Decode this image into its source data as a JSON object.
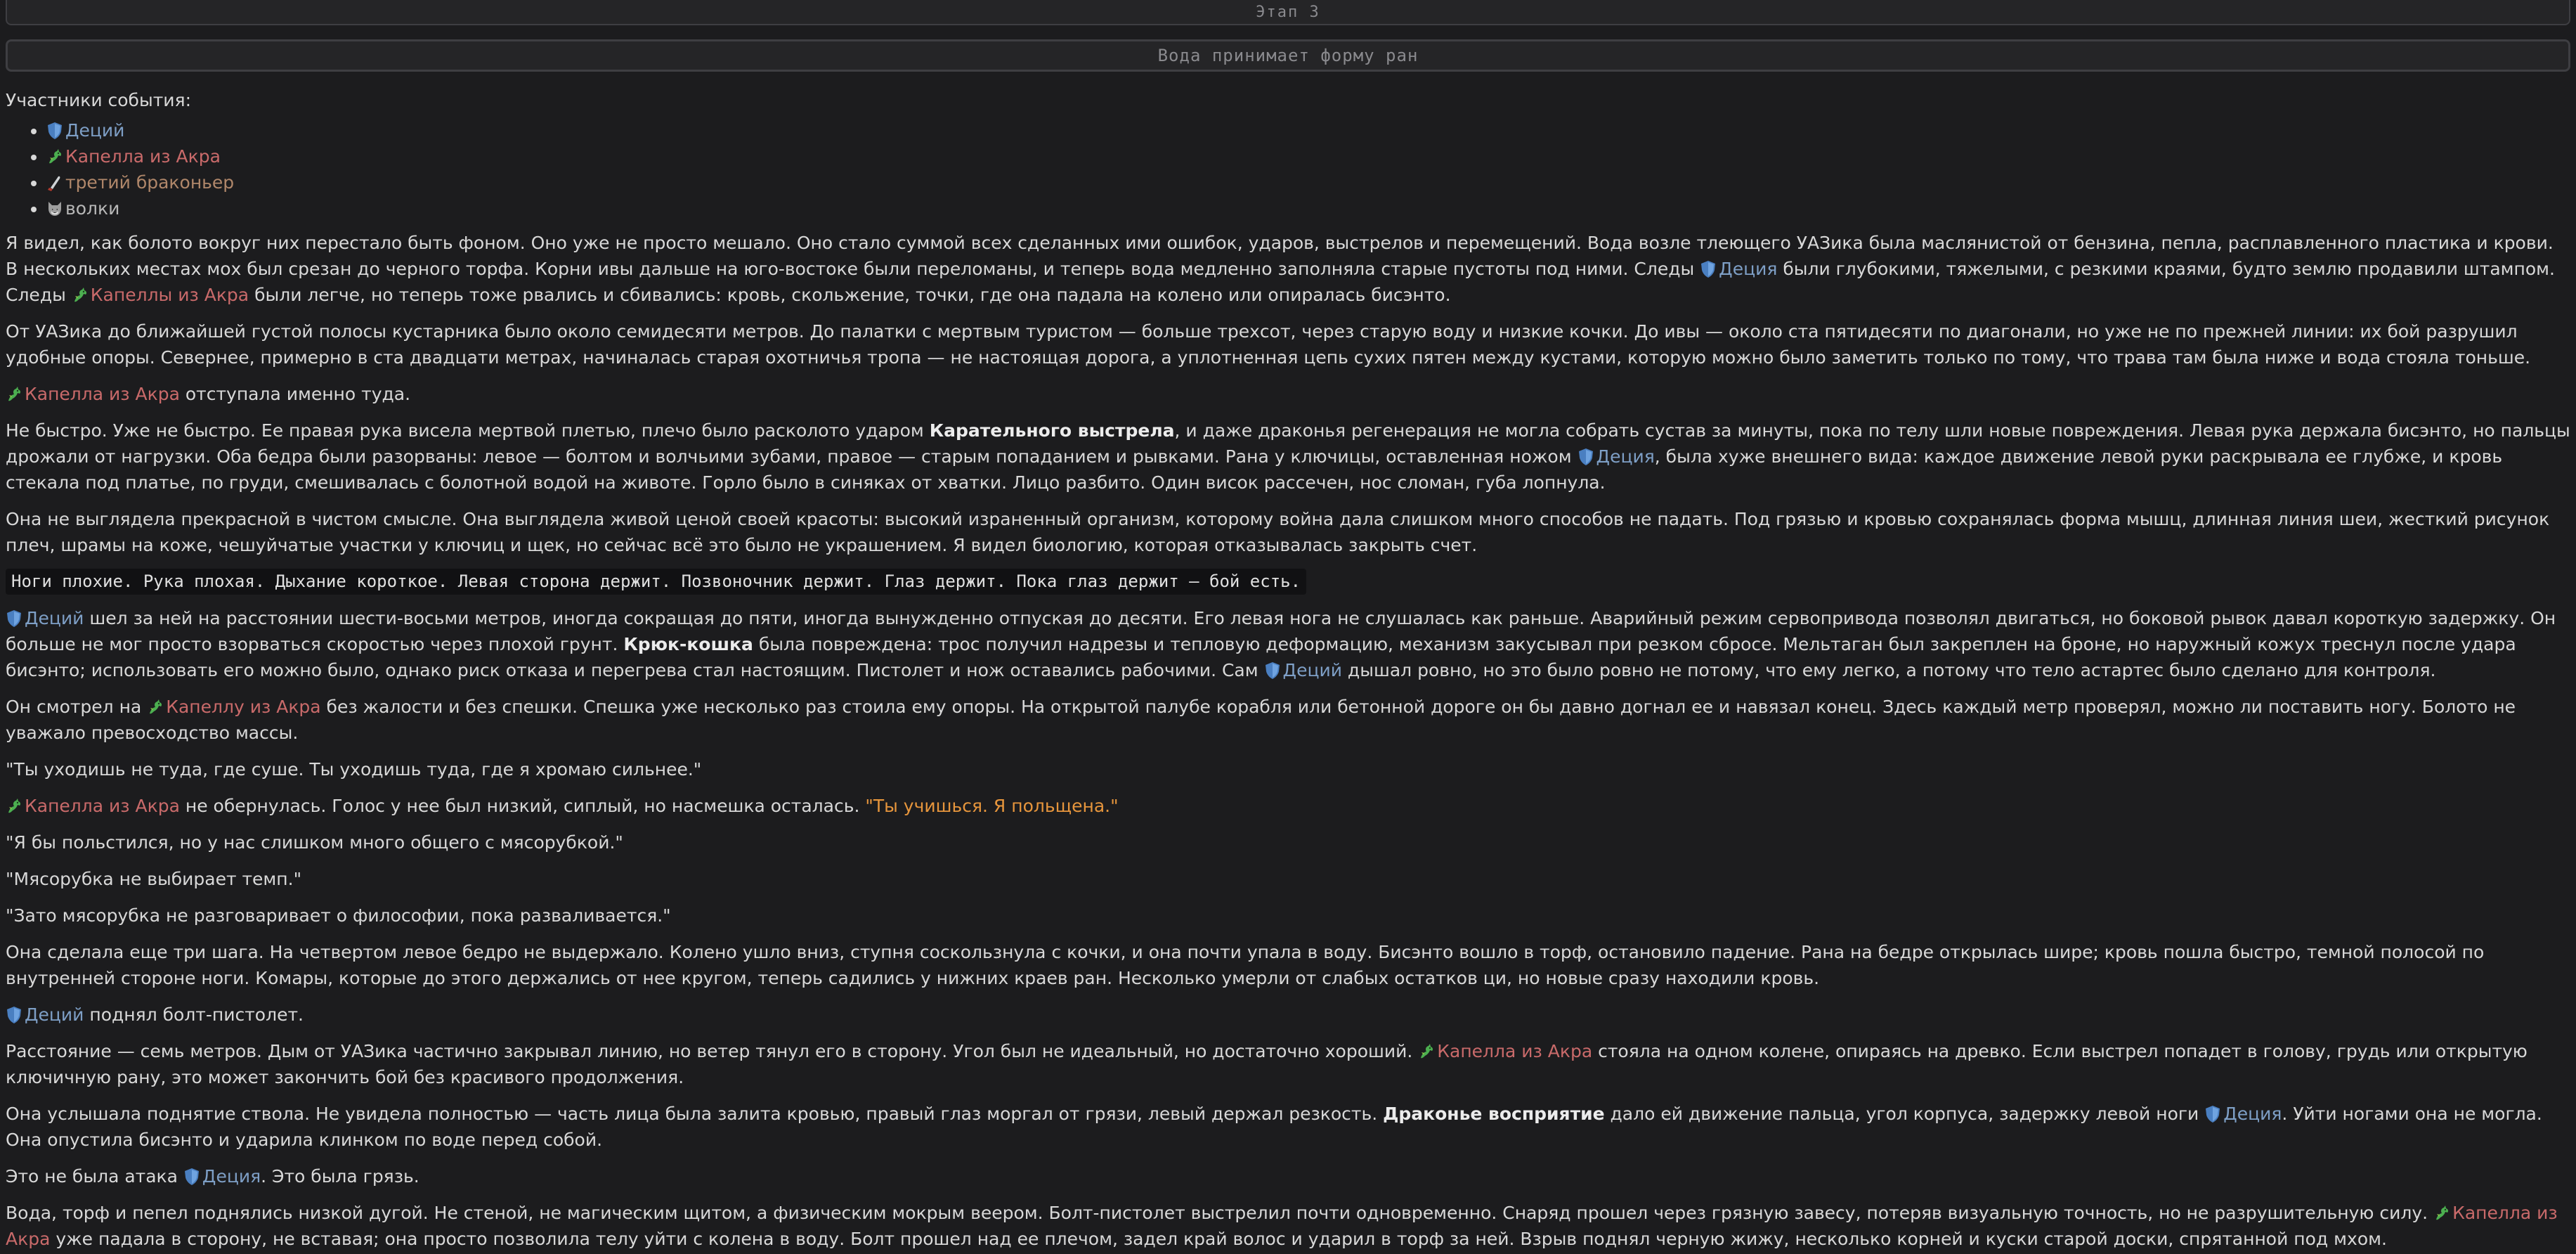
{
  "stage": "Этап 3",
  "event_title": "Вода принимает форму ран",
  "participants_title": "Участники события:",
  "participants": [
    {
      "name": "Деций",
      "icon": "shield-icon"
    },
    {
      "name": "Капелла из Акра",
      "icon": "dragon-icon"
    },
    {
      "name": "третий браконьер",
      "icon": "knife-icon"
    },
    {
      "name": "волки",
      "icon": "wolf-icon"
    }
  ],
  "names": {
    "decius": "Деций",
    "decius_gen": "Деция",
    "capella": "Капелла из Акра",
    "capella_acc": "Капеллу из Акра",
    "capella_gen": "Капеллы из Акра"
  },
  "terms": {
    "punitive_shot": "Карательного выстрела",
    "hook_cat": "Крюк-кошка",
    "draconic_perception": "Драконье восприятие"
  },
  "paragraphs": {
    "p1a": "Я видел, как болото вокруг них перестало быть фоном. Оно уже не просто мешало. Оно стало суммой всех сделанных ими ошибок, ударов, выстрелов и перемещений. Вода возле тлеющего УАЗика была маслянистой от бензина, пепла, расплавленного пластика и крови. В нескольких местах мох был срезан до черного торфа. Корни ивы дальше на юго-востоке были переломаны, и теперь вода медленно заполняла старые пустоты под ними. Следы ",
    "p1b": " были глубокими, тяжелыми, с резкими краями, будто землю продавили штампом. Следы ",
    "p1c": " были легче, но теперь тоже рвались и сбивались: кровь, скольжение, точки, где она падала на колено или опиралась бисэнто.",
    "p2": "От УАЗика до ближайшей густой полосы кустарника было около семидесяти метров. До палатки с мертвым туристом — больше трехсот, через старую воду и низкие кочки. До ивы — около ста пятидесяти по диагонали, но уже не по прежней линии: их бой разрушил удобные опоры. Севернее, примерно в ста двадцати метрах, начиналась старая охотничья тропа — не настоящая дорога, а уплотненная цепь сухих пятен между кустами, которую можно было заметить только по тому, что трава там была ниже и вода стояла тоньше.",
    "p3": " отступала именно туда.",
    "p4a": "Не быстро. Уже не быстро. Ее правая рука висела мертвой плетью, плечо было расколото ударом ",
    "p4b": ", и даже драконья регенерация не могла собрать сустав за минуты, пока по телу шли новые повреждения. Левая рука держала бисэнто, но пальцы дрожали от нагрузки. Оба бедра были разорваны: левое — болтом и волчьими зубами, правое — старым попаданием и рывками. Рана у ключицы, оставленная ножом ",
    "p4c": ", была хуже внешнего вида: каждое движение левой руки раскрывала ее глубже, и кровь стекала под платье, по груди, смешивалась с болотной водой на животе. Горло было в синяках от хватки. Лицо разбито. Один висок рассечен, нос сломан, губа лопнула.",
    "p5": "Она не выглядела прекрасной в чистом смысле. Она выглядела живой ценой своей красоты: высокий израненный организм, которому война дала слишком много способов не падать. Под грязью и кровью сохранялась форма мышц, длинная линия шеи, жесткий рисунок плеч, шрамы на коже, чешуйчатые участки у ключиц и щек, но сейчас всё это было не украшением. Я видел биологию, которая отказывалась закрыть счет.",
    "vitals": "Ноги плохие. Рука плохая. Дыхание короткое. Левая сторона держит. Позвоночник держит. Глаз держит. Пока глаз держит — бой есть.",
    "p6a": " шел за ней на расстоянии шести-восьми метров, иногда сокращая до пяти, иногда вынужденно отпуская до десяти. Его левая нога не слушалась как раньше. Аварийный режим сервопривода позволял двигаться, но боковой рывок давал короткую задержку. Он больше не мог просто взорваться скоростью через плохой грунт. ",
    "p6b": " была повреждена: трос получил надрезы и тепловую деформацию, механизм закусывал при резком сбросе. Мельтаган был закреплен на броне, но наружный кожух треснул после удара бисэнто; использовать его можно было, однако риск отказа и перегрева стал настоящим. Пистолет и нож оставались рабочими. Сам ",
    "p6c": " дышал ровно, но это было ровно не потому, что ему легко, а потому что тело астартес было сделано для контроля.",
    "p7a": "Он смотрел на ",
    "p7b": " без жалости и без спешки. Спешка уже несколько раз стоила ему опоры. На открытой палубе корабля или бетонной дороге он бы давно догнал ее и навязал конец. Здесь каждый метр проверял, можно ли поставить ногу. Болото не уважало превосходство массы.",
    "q1": "\"Ты уходишь не туда, где суше. Ты уходишь туда, где я хромаю сильнее.\"",
    "p8": " не обернулась. Голос у нее был низкий, сиплый, но насмешка осталась. ",
    "q2": "\"Ты учишься. Я польщена.\"",
    "q3": "\"Я бы польстился, но у нас слишком много общего с мясорубкой.\"",
    "q4": "\"Мясорубка не выбирает темп.\"",
    "q5": "\"Зато мясорубка не разговаривает о философии, пока разваливается.\"",
    "p9": "Она сделала еще три шага. На четвертом левое бедро не выдержало. Колено ушло вниз, ступня соскользнула с кочки, и она почти упала в воду. Бисэнто вошло в торф, остановило падение. Рана на бедре открылась шире; кровь пошла быстро, темной полосой по внутренней стороне ноги. Комары, которые до этого держались от нее кругом, теперь садились у нижних краев ран. Несколько умерли от слабых остатков ци, но новые сразу находили кровь.",
    "p10": " поднял болт-пистолет.",
    "p11a": "Расстояние — семь метров. Дым от УАЗика частично закрывал линию, но ветер тянул его в сторону. Угол был не идеальный, но достаточно хороший. ",
    "p11b": " стояла на одном колене, опираясь на древко. Если выстрел попадет в голову, грудь или открытую ключичную рану, это может закончить бой без красивого продолжения.",
    "p12a": "Она услышала поднятие ствола. Не увидела полностью — часть лица была залита кровью, правый глаз моргал от грязи, левый держал резкость. ",
    "p12b": " дало ей движение пальца, угол корпуса, задержку левой ноги ",
    "p12c": ". Уйти ногами она не могла. Она опустила бисэнто и ударила клинком по воде перед собой.",
    "p13a": "Это не была атака ",
    "p13b": ". Это была грязь.",
    "p14a": "Вода, торф и пепел поднялись низкой дугой. Не стеной, не магическим щитом, а физическим мокрым веером. Болт-пистолет выстрелил почти одновременно. Снаряд прошел через грязную завесу, потеряв визуальную точность, но не разрушительную силу. ",
    "p14b": " уже падала в сторону, не вставая; она просто позволила телу уйти с колена в воду. Болт прошел над ее плечом, задел край волос и ударил в торф за ней. Взрыв поднял черную жижу, несколько корней и куски старой доски, спрятанной под мхом."
  },
  "colors": {
    "decius": "#7e9fc6",
    "capella": "#c96a6a",
    "poacher": "#b0876a",
    "quote": "#e6953c",
    "background": "#1c1c1e"
  }
}
